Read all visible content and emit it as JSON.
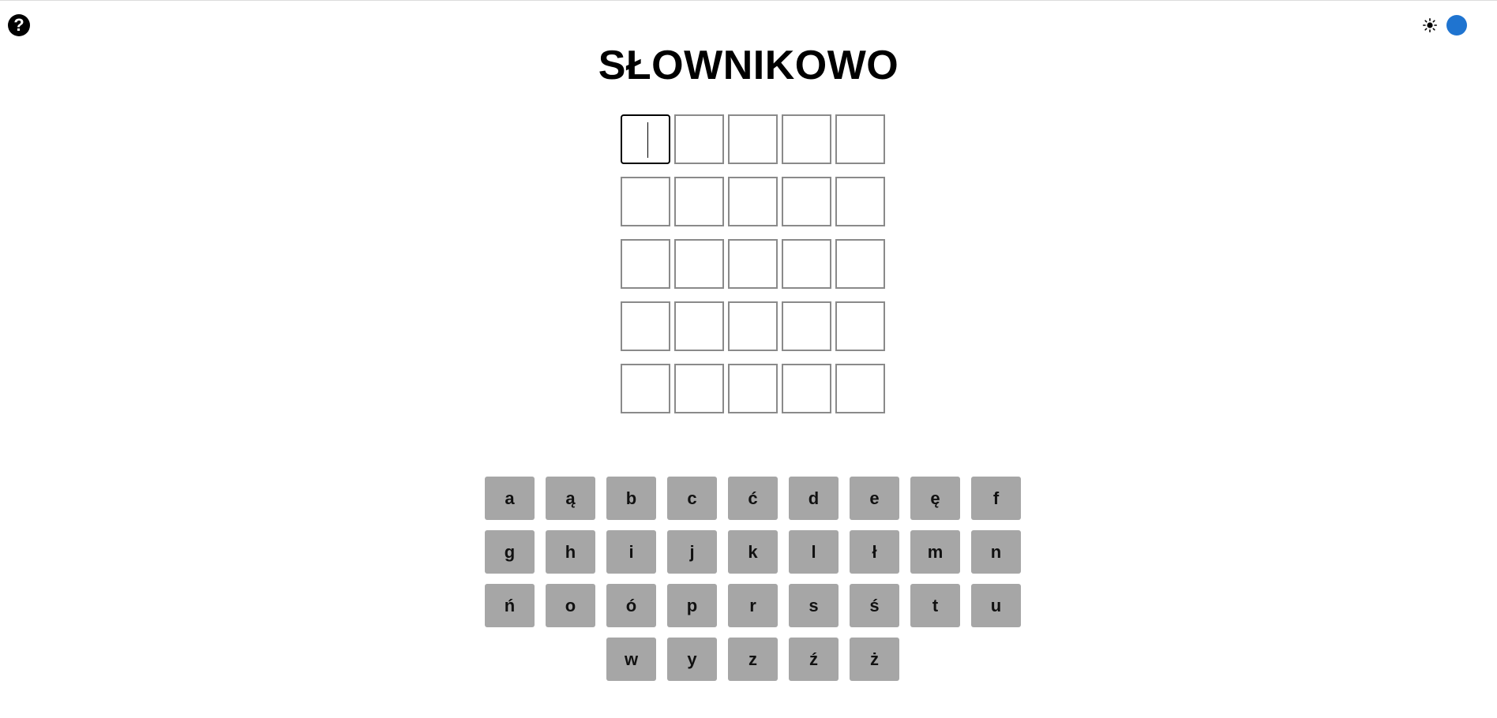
{
  "header": {
    "help_label": "?",
    "help_icon": "question-mark-icon",
    "theme": {
      "sun_icon": "sun-icon",
      "moon_icon": "moon-icon",
      "switch_color": "#1f74d0"
    }
  },
  "game": {
    "title": "SŁOWNIKOWO",
    "board": {
      "rows": 5,
      "columns": 5,
      "active_cell": [
        0,
        0
      ]
    }
  },
  "keyboard": {
    "rows": [
      [
        "a",
        "ą",
        "b",
        "c",
        "ć",
        "d",
        "e",
        "ę",
        "f"
      ],
      [
        "g",
        "h",
        "i",
        "j",
        "k",
        "l",
        "ł",
        "m",
        "n"
      ],
      [
        "ń",
        "o",
        "ó",
        "p",
        "r",
        "s",
        "ś",
        "t",
        "u"
      ],
      [
        "w",
        "y",
        "z",
        "ź",
        "ż"
      ]
    ],
    "key_color": "#a6a6a6"
  }
}
